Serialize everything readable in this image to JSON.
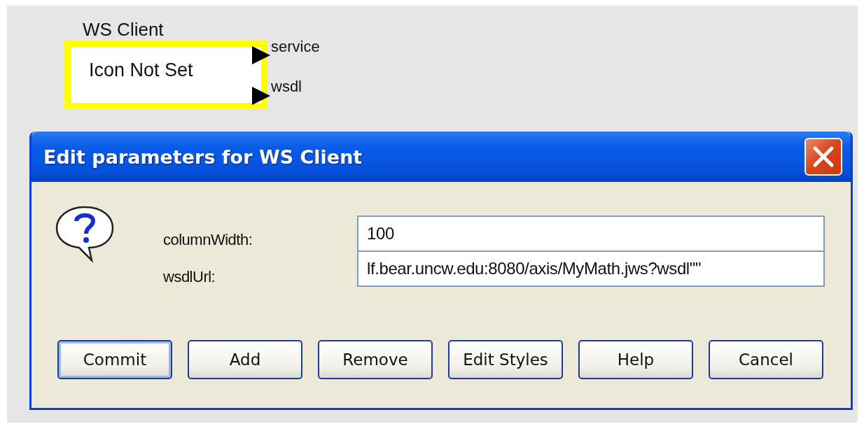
{
  "canvas": {
    "node": {
      "title": "WS Client",
      "body": "Icon Not Set",
      "selected": true,
      "ports": [
        {
          "label": "service"
        },
        {
          "label": "wsdl"
        }
      ]
    }
  },
  "dialog": {
    "title": "Edit parameters for WS Client",
    "parameters": [
      {
        "label": "columnWidth:",
        "value": "100"
      },
      {
        "label": "wsdlUrl:",
        "value": "lf.bear.uncw.edu:8080/axis/MyMath.jws?wsdl\"\""
      }
    ],
    "buttons": [
      {
        "label": "Commit",
        "default": true
      },
      {
        "label": "Add",
        "default": false
      },
      {
        "label": "Remove",
        "default": false
      },
      {
        "label": "Edit Styles",
        "default": false
      },
      {
        "label": "Help",
        "default": false
      },
      {
        "label": "Cancel",
        "default": false
      }
    ]
  }
}
